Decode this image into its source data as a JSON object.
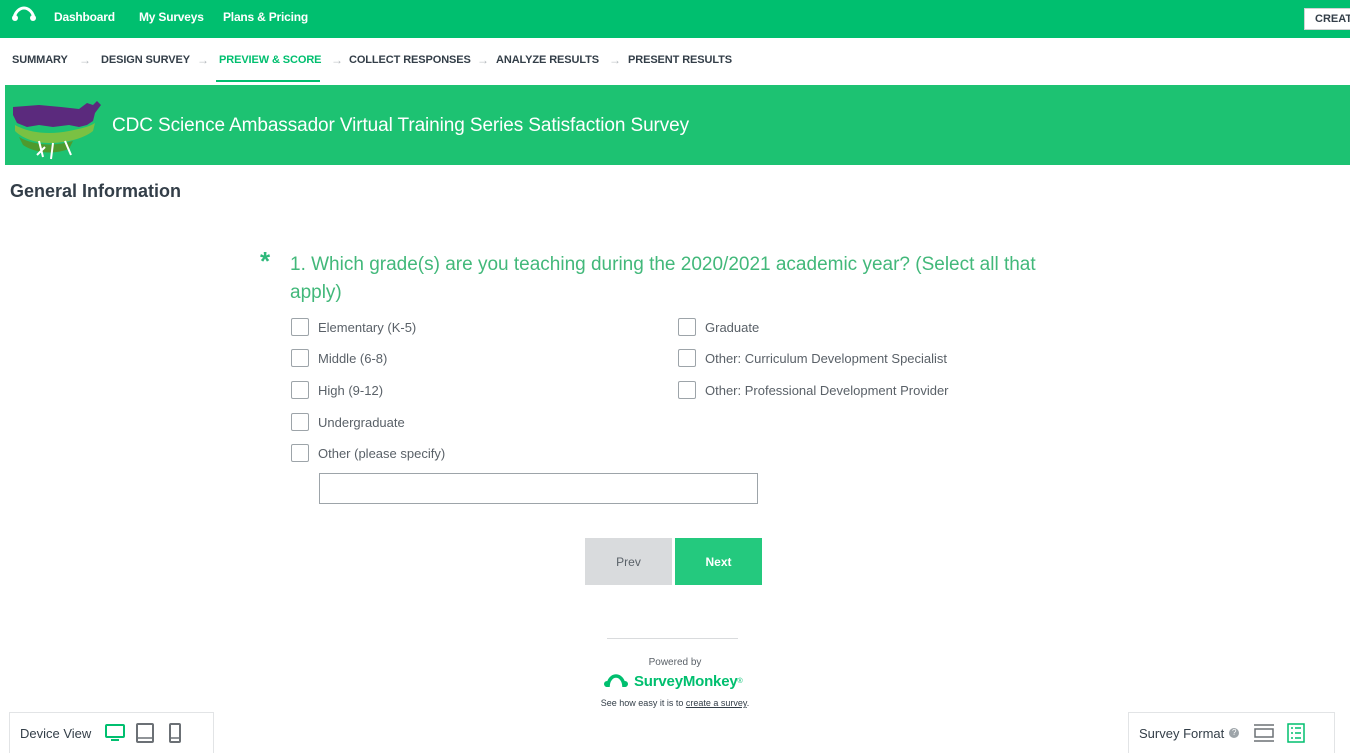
{
  "topnav": {
    "links": [
      "Dashboard",
      "My Surveys",
      "Plans & Pricing"
    ],
    "create_label": "CREATE SURVEY"
  },
  "steps": [
    {
      "label": "SUMMARY",
      "active": false
    },
    {
      "label": "DESIGN SURVEY",
      "active": false
    },
    {
      "label": "PREVIEW & SCORE",
      "active": true
    },
    {
      "label": "COLLECT RESPONSES",
      "active": false
    },
    {
      "label": "ANALYZE RESULTS",
      "active": false
    },
    {
      "label": "PRESENT RESULTS",
      "active": false
    }
  ],
  "banner": {
    "title": "CDC Science Ambassador Virtual Training Series Satisfaction Survey"
  },
  "section": {
    "title": "General Information"
  },
  "question": {
    "required_mark": "*",
    "text": "1. Which grade(s) are you teaching during the 2020/2021 academic year? (Select all that apply)",
    "options_left": [
      "Elementary (K-5)",
      "Middle (6-8)",
      "High (9-12)",
      "Undergraduate",
      "Other (please specify)"
    ],
    "options_right": [
      "Graduate",
      "Other: Curriculum Development Specialist",
      "Other: Professional Development Provider"
    ],
    "other_value": ""
  },
  "buttons": {
    "prev": "Prev",
    "next": "Next"
  },
  "footer": {
    "powered_by": "Powered by",
    "brand": "SurveyMonkey",
    "see_how_prefix": "See how easy it is to ",
    "see_how_link": "create a survey",
    "see_how_suffix": "."
  },
  "device_view": {
    "label": "Device View",
    "icons": [
      "desktop-icon",
      "tablet-icon",
      "phone-icon"
    ],
    "selected": "desktop-icon"
  },
  "survey_format": {
    "label": "Survey Format",
    "icons": [
      "one-question-at-a-time-icon",
      "classic-format-icon"
    ],
    "selected": "classic-format-icon"
  },
  "colors": {
    "brand_green": "#00bf6f",
    "question_green": "#42b87a",
    "banner_green": "#1dc272"
  }
}
